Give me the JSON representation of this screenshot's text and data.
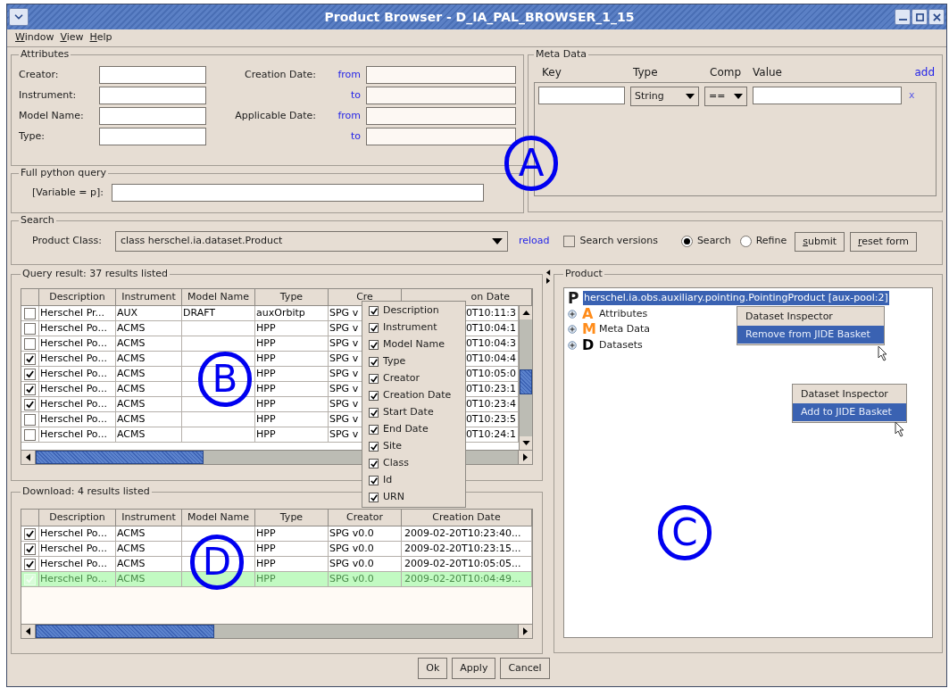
{
  "window": {
    "title": "Product Browser - D_IA_PAL_BROWSER_1_15"
  },
  "menu": [
    {
      "label": "Window"
    },
    {
      "label": "View"
    },
    {
      "label": "Help"
    }
  ],
  "attributes": {
    "title": "Attributes",
    "fields": [
      {
        "label": "Creator:"
      },
      {
        "label": "Instrument:"
      },
      {
        "label": "Model Name:"
      },
      {
        "label": "Type:"
      }
    ],
    "dates": [
      {
        "label": "Creation Date:",
        "qualifier": "from"
      },
      {
        "qualifier": "to"
      },
      {
        "label": "Applicable Date:",
        "qualifier": "from"
      },
      {
        "qualifier": "to"
      }
    ]
  },
  "python_query": {
    "title": "Full python query",
    "label": "[Variable = p]:"
  },
  "meta_data": {
    "title": "Meta Data",
    "columns": [
      "Key",
      "Type",
      "Comp",
      "Value"
    ],
    "add": "add",
    "row": {
      "type": "String",
      "comp": "==",
      "remove": "x"
    }
  },
  "search": {
    "title": "Search",
    "label": "Product Class:",
    "product_class": "class herschel.ia.dataset.Product",
    "reload": "reload",
    "versions": {
      "label": "Search versions",
      "checked": false
    },
    "modes": [
      {
        "label": "Search",
        "selected": true
      },
      {
        "label": "Refine",
        "selected": false
      }
    ],
    "buttons": [
      "submit",
      "reset form"
    ]
  },
  "query_result": {
    "title": "Query result: 37 results listed",
    "columns": [
      "Description",
      "Instrument",
      "Model Name",
      "Type",
      "Cre",
      "on Date"
    ],
    "rows": [
      {
        "checked": false,
        "description": "Herschel Pr...",
        "instrument": "AUX",
        "model_name": "DRAFT",
        "type": "auxOrbitp",
        "creator": "SPG v",
        "creation_date": "0T10:11:3"
      },
      {
        "checked": false,
        "description": "Herschel Po...",
        "instrument": "ACMS",
        "type": "HPP",
        "creator": "SPG v",
        "creation_date": "0T10:04:1"
      },
      {
        "checked": false,
        "description": "Herschel Po...",
        "instrument": "ACMS",
        "type": "HPP",
        "creator": "SPG v",
        "creation_date": "0T10:04:3"
      },
      {
        "checked": true,
        "description": "Herschel Po...",
        "instrument": "ACMS",
        "type": "HPP",
        "creator": "SPG v",
        "creation_date": "0T10:04:4"
      },
      {
        "checked": true,
        "description": "Herschel Po...",
        "instrument": "ACMS",
        "type": "HPP",
        "creator": "SPG v",
        "creation_date": "0T10:05:0"
      },
      {
        "checked": true,
        "description": "Herschel Po...",
        "instrument": "ACMS",
        "type": "HPP",
        "creator": "SPG v",
        "creation_date": "0T10:23:1"
      },
      {
        "checked": true,
        "description": "Herschel Po...",
        "instrument": "ACMS",
        "type": "HPP",
        "creator": "SPG v",
        "creation_date": "0T10:23:4"
      },
      {
        "checked": false,
        "description": "Herschel Po...",
        "instrument": "ACMS",
        "type": "HPP",
        "creator": "SPG v",
        "creation_date": "0T10:23:5"
      },
      {
        "checked": false,
        "description": "Herschel Po...",
        "instrument": "ACMS",
        "type": "HPP",
        "creator": "SPG v",
        "creation_date": "0T10:24:1"
      }
    ]
  },
  "column_menu": [
    {
      "label": "Description",
      "checked": true
    },
    {
      "label": "Instrument",
      "checked": true
    },
    {
      "label": "Model Name",
      "checked": true
    },
    {
      "label": "Type",
      "checked": true
    },
    {
      "label": "Creator",
      "checked": true
    },
    {
      "label": "Creation Date",
      "checked": true
    },
    {
      "label": "Start Date",
      "checked": true
    },
    {
      "label": "End Date",
      "checked": true
    },
    {
      "label": "Site",
      "checked": true
    },
    {
      "label": "Class",
      "checked": true
    },
    {
      "label": "Id",
      "checked": true
    },
    {
      "label": "URN",
      "checked": true
    }
  ],
  "download": {
    "title": "Download: 4 results listed",
    "columns": [
      "Description",
      "Instrument",
      "Model Name",
      "Type",
      "Creator",
      "Creation Date"
    ],
    "rows": [
      {
        "checked": true,
        "selected": false,
        "description": "Herschel Po...",
        "instrument": "ACMS",
        "type": "HPP",
        "creator": "SPG v0.0",
        "creation_date": "2009-02-20T10:23:40..."
      },
      {
        "checked": true,
        "selected": false,
        "description": "Herschel Po...",
        "instrument": "ACMS",
        "type": "HPP",
        "creator": "SPG v0.0",
        "creation_date": "2009-02-20T10:23:15..."
      },
      {
        "checked": true,
        "selected": false,
        "description": "Herschel Po...",
        "instrument": "ACMS",
        "type": "HPP",
        "creator": "SPG v0.0",
        "creation_date": "2009-02-20T10:05:05..."
      },
      {
        "checked": true,
        "selected": true,
        "description": "Herschel Po...",
        "instrument": "ACMS",
        "type": "HPP",
        "creator": "SPG v0.0",
        "creation_date": "2009-02-20T10:04:49..."
      }
    ]
  },
  "product": {
    "title": "Product",
    "root": {
      "icon": "P",
      "label": "herschel.ia.obs.auxiliary.pointing.PointingProduct [aux-pool:2]",
      "selected": true,
      "children": [
        {
          "icon": "A",
          "label": "Attributes",
          "color": "#ff8c1a"
        },
        {
          "icon": "M",
          "label": "Meta Data",
          "color": "#ff8c1a"
        },
        {
          "icon": "D",
          "label": "Datasets",
          "color": "#000000"
        }
      ]
    }
  },
  "context_menus": [
    {
      "items": [
        {
          "label": "Dataset Inspector",
          "selected": false
        },
        {
          "label": "Remove from JIDE Basket",
          "selected": true
        }
      ]
    },
    {
      "items": [
        {
          "label": "Dataset Inspector",
          "selected": false
        },
        {
          "label": "Add to JIDE Basket",
          "selected": true
        }
      ]
    }
  ],
  "buttons": [
    "Ok",
    "Apply",
    "Cancel"
  ],
  "annotations": [
    "A",
    "B",
    "C",
    "D"
  ]
}
